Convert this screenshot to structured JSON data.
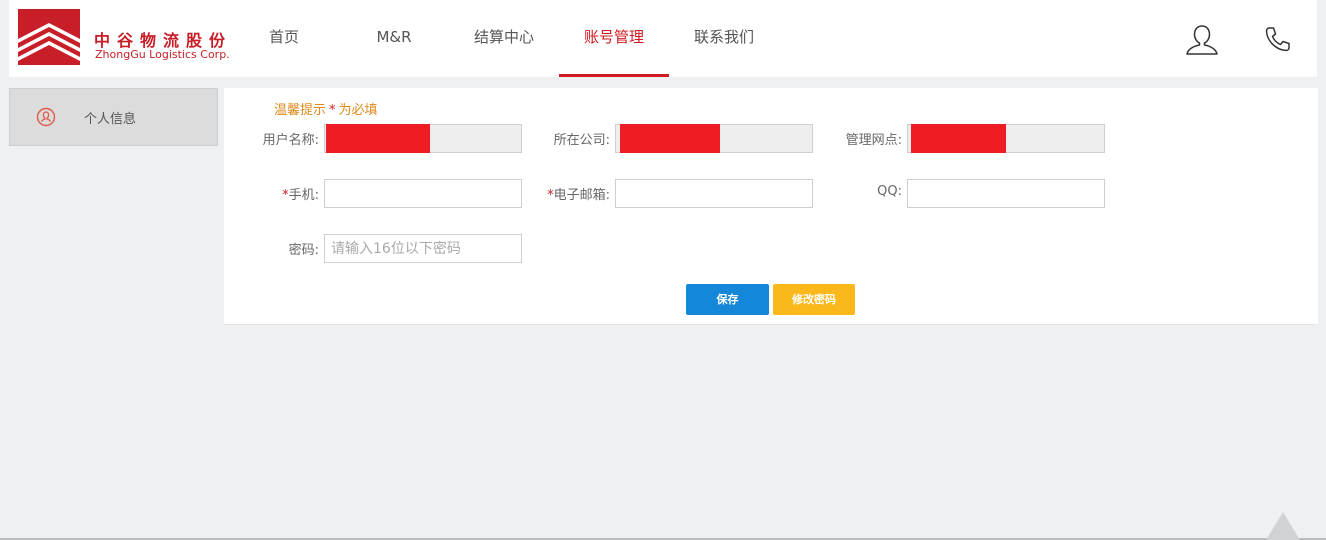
{
  "brand": {
    "name_cn": "中谷物流股份",
    "name_en": "ZhongGu Logistics Corp.",
    "color": "#c81e28"
  },
  "nav": {
    "items": [
      {
        "label": "首页"
      },
      {
        "label": "M&R"
      },
      {
        "label": "结算中心"
      },
      {
        "label": "账号管理",
        "active": true
      },
      {
        "label": "联系我们"
      }
    ],
    "active_color": "#d11a20"
  },
  "header_icons": {
    "user": "user-icon",
    "phone": "phone-icon"
  },
  "sidebar": {
    "items": [
      {
        "label": "个人信息",
        "icon": "user-icon"
      }
    ]
  },
  "form": {
    "tip": {
      "prefix": "温馨提示",
      "star": "*",
      "suffix": "为必填"
    },
    "username_label": "用户名称:",
    "company_label": "所在公司:",
    "branch_label": "管理网点:",
    "required_mark": "*",
    "phone_label": "手机:",
    "email_label": "电子邮箱:",
    "qq_label": "QQ:",
    "password_label": "密码:",
    "password_placeholder": "请输入16位以下密码",
    "save_label": "保存",
    "change_password_label": "修改密码"
  },
  "colors": {
    "save_button": "#1487d8",
    "change_password_button": "#fbb81b",
    "tip": "#e08a1e",
    "redaction": "#ee1c25"
  }
}
